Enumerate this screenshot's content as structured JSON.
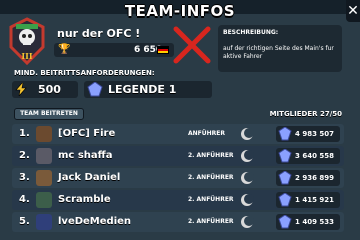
{
  "header": {
    "title": "TEAM-INFOS"
  },
  "club": {
    "name": "nur der OFC !",
    "trophies": "6 650",
    "flag_colors": [
      "#000000",
      "#dd0000",
      "#ffce00"
    ],
    "description_heading": "BESCHREIBUNG:",
    "description": "auf der richtigen Seite des Main's    fur aktive Fahrer"
  },
  "requirements": {
    "label": "MIND. BEITRITTSANFORDERUNGEN:",
    "trophies": "500",
    "league": "LEGENDE 1"
  },
  "join_button": "TEAM BEITRETEN",
  "members_count": "MITGLIEDER 27/50",
  "members": [
    {
      "rank": "1.",
      "name": "[OFC] Fire",
      "role": "ANFÜHRER",
      "trophies": "4 983 507",
      "avatar_color": "#6b4a2f"
    },
    {
      "rank": "2.",
      "name": "mc shaffa",
      "role": "2. ANFÜHRER",
      "trophies": "3 640 558",
      "avatar_color": "#5a5a66"
    },
    {
      "rank": "3.",
      "name": "Jack Daniel",
      "role": "2. ANFÜHRER",
      "trophies": "2 936 899",
      "avatar_color": "#7a5a3a"
    },
    {
      "rank": "4.",
      "name": "Scramble",
      "role": "2. ANFÜHRER",
      "trophies": "1 415 921",
      "avatar_color": "#3c5e4a"
    },
    {
      "rank": "5.",
      "name": "lveDeMedien",
      "role": "2. ANFÜHRER",
      "trophies": "1 409 533",
      "avatar_color": "#2f3f7a"
    }
  ],
  "colors": {
    "accent_red": "#d8261e",
    "gold": "#f2c230",
    "gem": "#8aa0ff"
  }
}
